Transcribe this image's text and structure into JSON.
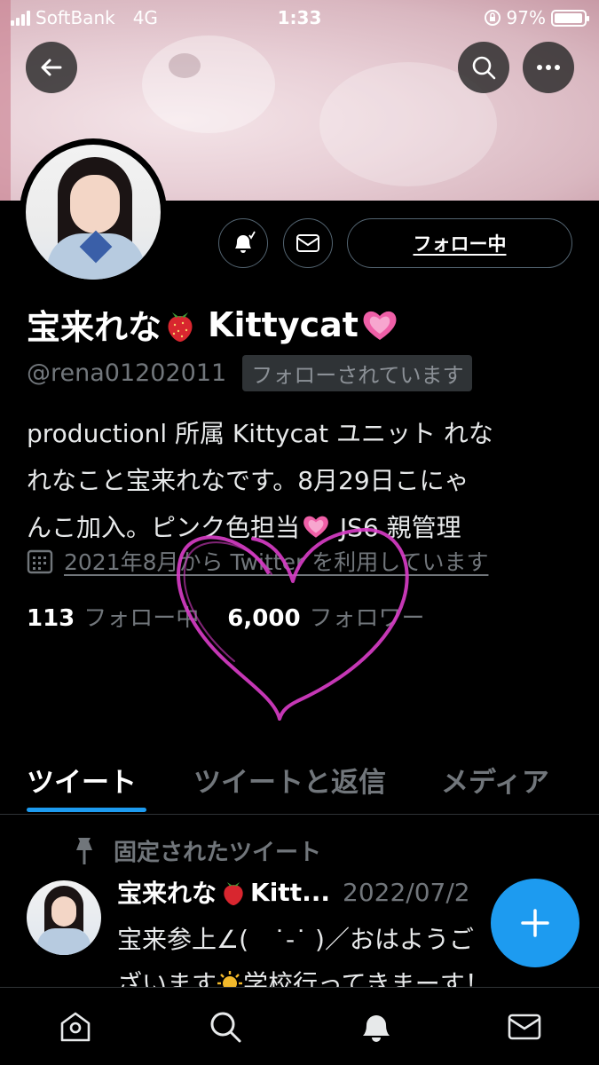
{
  "status_bar": {
    "carrier": "SoftBank",
    "network": "4G",
    "time": "1:33",
    "battery": "97%",
    "battery_level": 0.97
  },
  "header": {
    "back_icon": "arrow-left-icon",
    "search_icon": "search-icon",
    "more_icon": "more-dots-icon"
  },
  "profile": {
    "name_prefix": "宝来れな",
    "name_suffix": "Kittycat",
    "handle": "@rena01202011",
    "follows_you": "フォローされています",
    "follow_button": "フォロー中",
    "bio_line1": "productionl 所属 Kittycat ユニット れな",
    "bio_line2": "れなこと宝来れなです。8月29日こにゃ",
    "bio_line3_a": "んこ加入。ピンク色担当",
    "bio_line3_b": " JS6 親管理",
    "joined": "2021年8月から Twitter を利用しています",
    "following_count": "113",
    "following_label": "フォロー中",
    "followers_count": "6,000",
    "followers_label": "フォロワー"
  },
  "tabs": [
    {
      "label": "ツイート",
      "active": true
    },
    {
      "label": "ツイートと返信",
      "active": false
    },
    {
      "label": "メディア",
      "active": false
    }
  ],
  "pinned_tweet": {
    "pinned_label": "固定されたツイート",
    "author": "宝来れな",
    "author_suffix": "Kitt...",
    "date": "2022/07/2",
    "text_line1": "宝来参上∠(　˙-˙ )／おはようご",
    "text_line2": "ざいます",
    "text_line2_b": "学校行ってきまーす！"
  },
  "colors": {
    "accent": "#1d9bf0",
    "background": "#000000",
    "secondary_text": "#71767b",
    "drawn_heart": "#d63cc4"
  },
  "bottom_nav": [
    "home-icon",
    "search-icon",
    "bell-icon",
    "mail-icon"
  ]
}
